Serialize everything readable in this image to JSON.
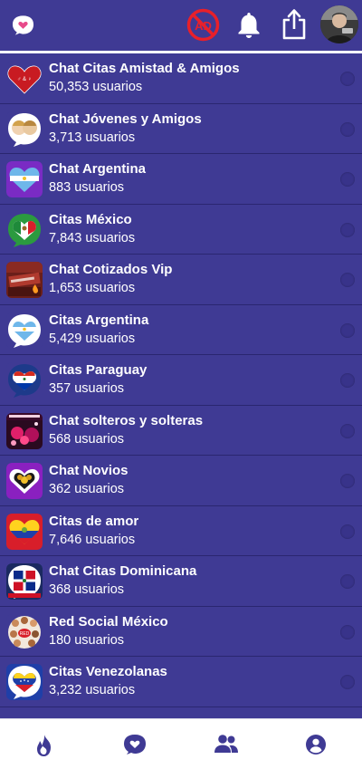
{
  "header": {
    "logo_icon": "heart-chat-icon",
    "ad_icon": "no-ads-icon",
    "bell_icon": "bell-icon",
    "share_icon": "share-icon",
    "avatar_icon": "profile-avatar"
  },
  "rooms": [
    {
      "title": "Chat Citas Amistad & Amigos",
      "count": "50,353 usuarios",
      "color": "#c81b22"
    },
    {
      "title": "Chat Jóvenes y Amigos",
      "count": "3,713 usuarios",
      "color": "#e9c9a0"
    },
    {
      "title": "Chat Argentina",
      "count": "883 usuarios",
      "color": "#7a2bc4"
    },
    {
      "title": "Citas México",
      "count": "7,843 usuarios",
      "color": "#2b9a3f"
    },
    {
      "title": "Chat Cotizados Vip",
      "count": "1,653 usuarios",
      "color": "#8a2a22"
    },
    {
      "title": "Citas Argentina",
      "count": "5,429 usuarios",
      "color": "#5fa8e0"
    },
    {
      "title": "Citas Paraguay",
      "count": "357 usuarios",
      "color": "#1d3a8a"
    },
    {
      "title": "Chat solteros y solteras",
      "count": "568 usuarios",
      "color": "#b0105a"
    },
    {
      "title": "Chat Novios",
      "count": "362 usuarios",
      "color": "#8a20c0"
    },
    {
      "title": "Citas de amor",
      "count": "7,646 usuarios",
      "color": "#d81e2a"
    },
    {
      "title": "Chat Citas Dominicana",
      "count": "368 usuarios",
      "color": "#1b2a60"
    },
    {
      "title": "Red Social México",
      "count": "180 usuarios",
      "color": "#f2e8dc"
    },
    {
      "title": "Citas Venezolanas",
      "count": "3,232 usuarios",
      "color": "#1f3fa8"
    }
  ],
  "nav": [
    {
      "icon": "flame-icon"
    },
    {
      "icon": "heart-chat-icon"
    },
    {
      "icon": "group-icon"
    },
    {
      "icon": "account-icon"
    }
  ],
  "colors": {
    "background": "#3f3a94",
    "accent_pink": "#e84a8a",
    "ad_red": "#e8202a",
    "nav_icon": "#3f3a94"
  }
}
